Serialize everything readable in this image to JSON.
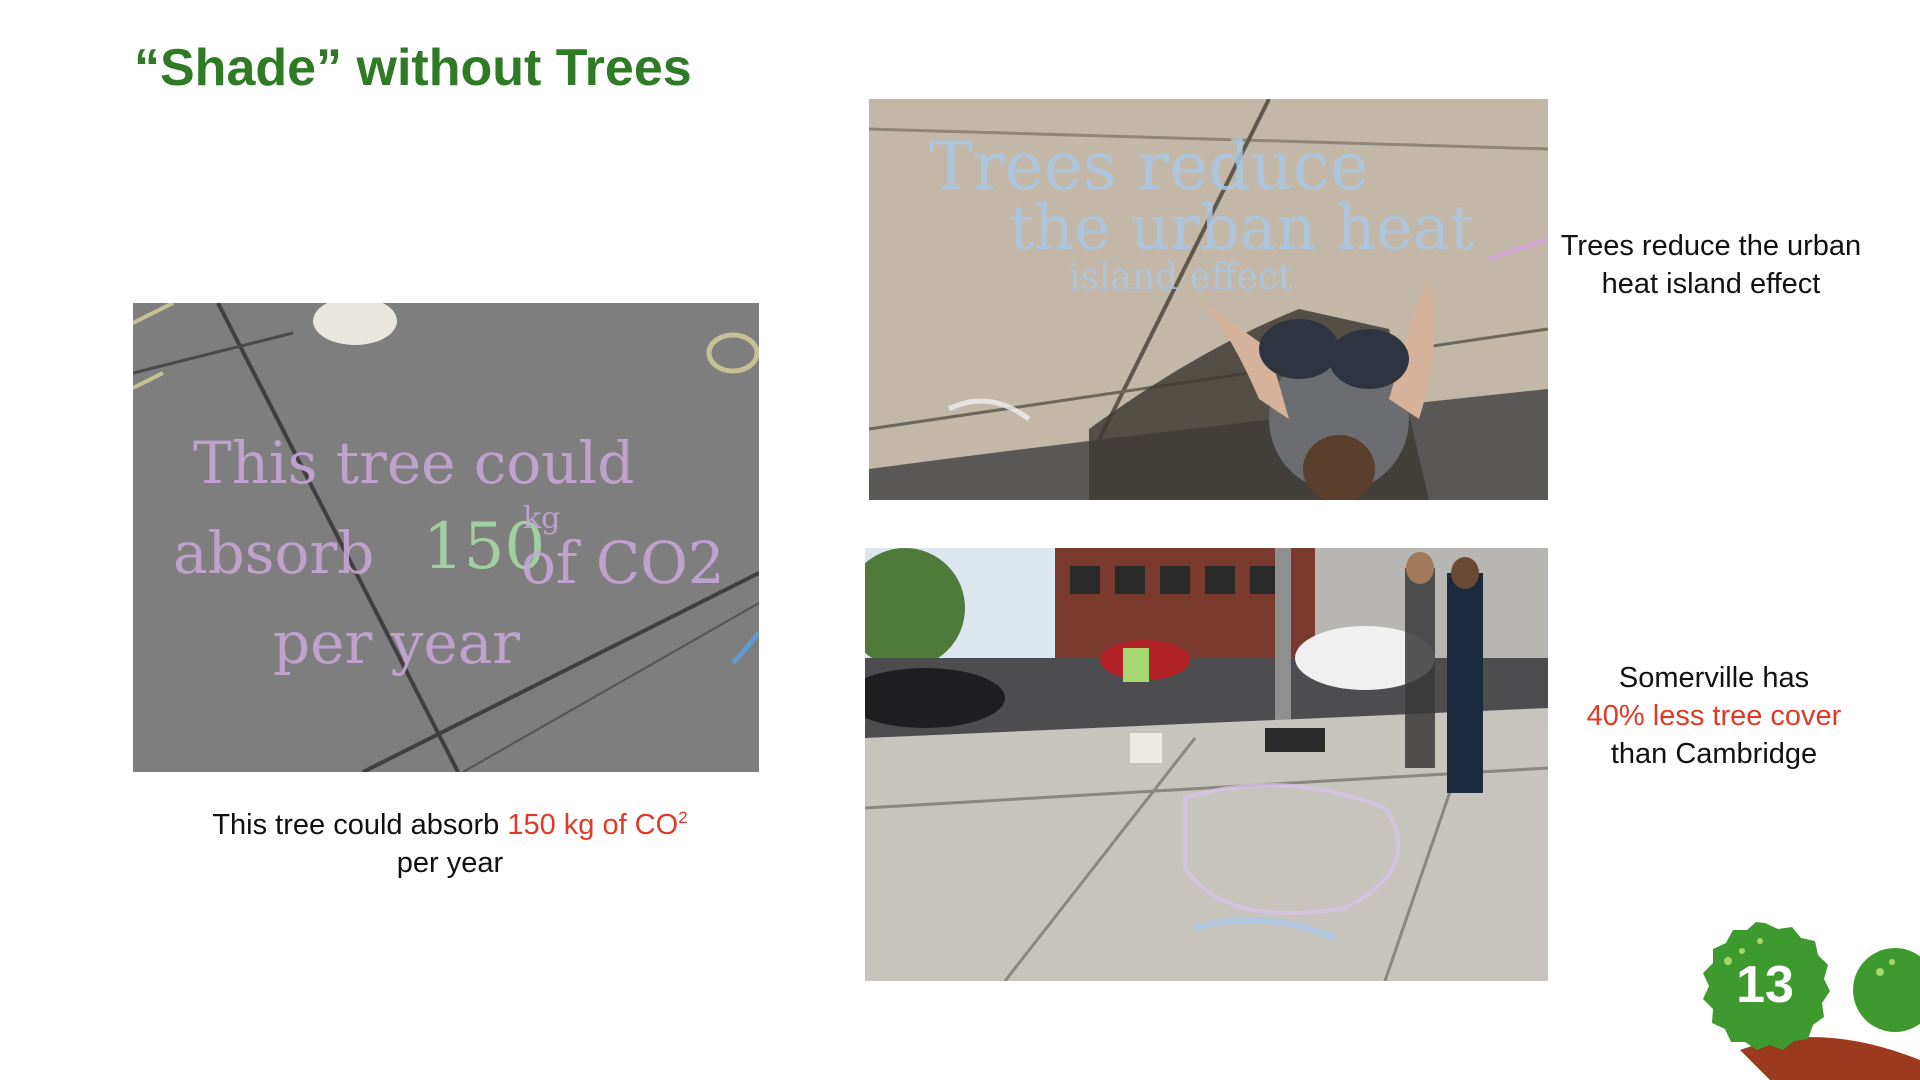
{
  "slide": {
    "title": "“Shade” without Trees",
    "page_number": "13"
  },
  "captions": {
    "co2": {
      "before": "This tree could absorb ",
      "highlight": "150 kg of CO",
      "superscript": "2",
      "after": "per year"
    },
    "heat": {
      "text": "Trees reduce the urban heat island effect"
    },
    "cover": {
      "line1": "Somerville has",
      "highlight": "40% less tree cover",
      "line3": "than Cambridge"
    }
  },
  "photos": {
    "sidewalk": {
      "chalk_line1": "This tree could",
      "chalk_line2a": "absorb",
      "chalk_number": "150",
      "chalk_unit": "kg",
      "chalk_line2b": "of CO2",
      "chalk_line3": "per year"
    },
    "drawing": {
      "chalk_line1": "Trees reduce",
      "chalk_line2": "the urban heat",
      "chalk_line3": "island effect"
    }
  },
  "colors": {
    "title_green": "#2e7a25",
    "highlight_red": "#e03a26",
    "badge_green": "#3e9a2e",
    "branch_brown": "#9b3a1d"
  }
}
